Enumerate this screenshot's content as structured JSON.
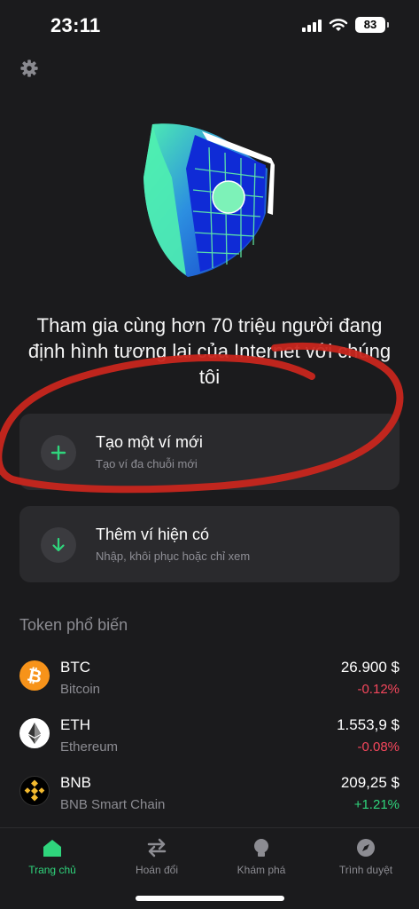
{
  "status": {
    "time": "23:11",
    "battery": "83"
  },
  "headline": "Tham gia cùng hơn 70 triệu người đang định hình tương lai của Internet với chúng tôi",
  "actions": [
    {
      "title": "Tạo một ví mới",
      "subtitle": "Tạo ví đa chuỗi mới",
      "icon": "plus-icon"
    },
    {
      "title": "Thêm ví hiện có",
      "subtitle": "Nhập, khôi phục hoặc chỉ xem",
      "icon": "arrow-down-icon"
    }
  ],
  "popular": {
    "title": "Token phổ biến",
    "tokens": [
      {
        "symbol": "BTC",
        "name": "Bitcoin",
        "price": "26.900 $",
        "change": "-0.12%",
        "icon": "bitcoin-icon"
      },
      {
        "symbol": "ETH",
        "name": "Ethereum",
        "price": "1.553,9 $",
        "change": "-0.08%",
        "icon": "ethereum-icon"
      },
      {
        "symbol": "BNB",
        "name": "BNB Smart Chain",
        "price": "209,25 $",
        "change": "+1.21%",
        "icon": "bnb-icon"
      }
    ]
  },
  "nav": [
    {
      "label": "Trang chủ",
      "icon": "home-icon",
      "active": true
    },
    {
      "label": "Hoán đổi",
      "icon": "swap-icon",
      "active": false
    },
    {
      "label": "Khám phá",
      "icon": "bulb-icon",
      "active": false
    },
    {
      "label": "Trình duyệt",
      "icon": "compass-icon",
      "active": false
    }
  ],
  "colors": {
    "background": "#1b1b1d",
    "card": "#2a2a2d",
    "accent": "#2fd57c",
    "negative": "#f5475c",
    "annotation": "#c8261d"
  }
}
